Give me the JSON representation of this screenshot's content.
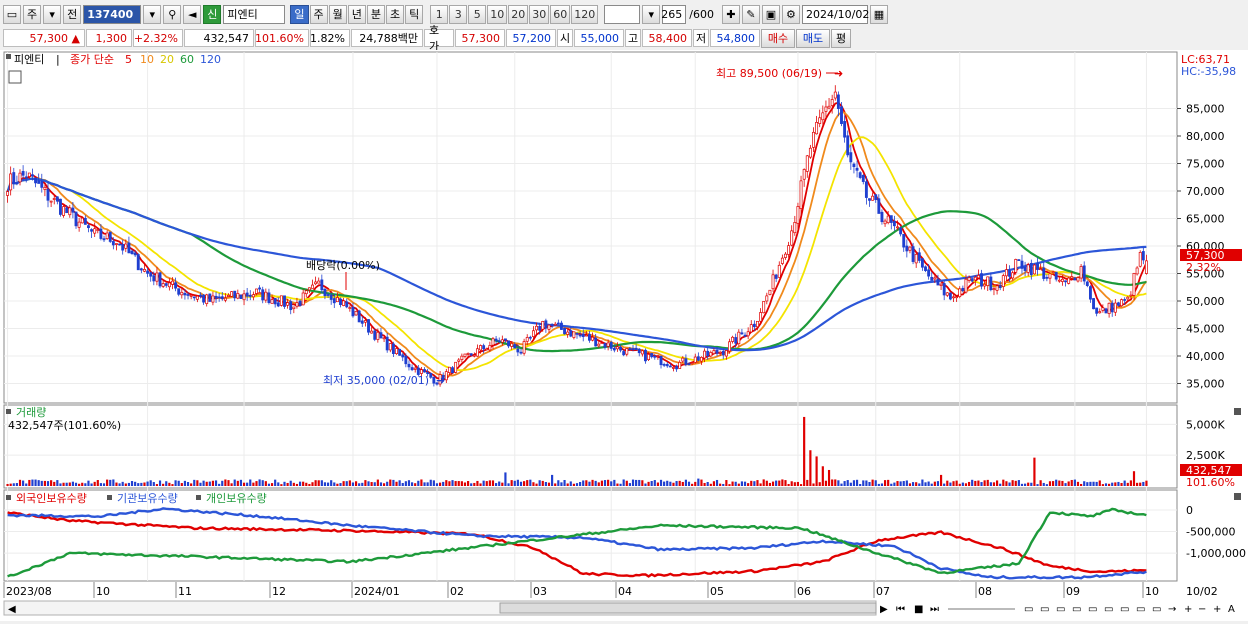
{
  "toolbar": {
    "type_label": "주",
    "prev_label": "전",
    "code": "137400",
    "credit_label": "신",
    "name": "피엔티",
    "periods": [
      "일",
      "주",
      "월",
      "년",
      "분",
      "초",
      "틱"
    ],
    "selected_period": "일",
    "nums": [
      "1",
      "3",
      "5",
      "10",
      "20",
      "30",
      "60",
      "120"
    ],
    "count": "265",
    "count_max": "/600",
    "date": "2024/10/02"
  },
  "quote": {
    "price": "57,300",
    "arrow": "▲",
    "change": "1,300",
    "change_pct": "+2.32%",
    "volume": "432,547",
    "vol_ratio": "101.60%",
    "turnover": "1.82%",
    "amount": "24,788백만",
    "hoga_label": "호가",
    "ask": "57,300",
    "bid": "57,200",
    "open_label": "시",
    "open": "55,000",
    "high_label": "고",
    "high": "58,400",
    "low_label": "저",
    "low": "54,800",
    "buy_label": "매수",
    "sell_label": "매도",
    "pyeong_label": "평"
  },
  "price_panel": {
    "name": "피엔티",
    "ma_title": "종가 단순",
    "ma_periods": [
      "5",
      "10",
      "20",
      "60",
      "120"
    ],
    "lc": "LC:63,71",
    "hc": "HC:-35,98",
    "high_note": "최고 89,500 (06/19)",
    "low_note": "최저 35,000 (02/01)",
    "div_note": "배당락(0.00%)",
    "price_tag": "57,300",
    "pct_tag": "2.32%"
  },
  "volume_panel": {
    "title": "거래량",
    "info": "432,547주(101.60%)",
    "tag": "432,547",
    "pct_tag": "101.60%"
  },
  "holdings_panel": {
    "legend": [
      "외국인보유수량",
      "기관보유수량",
      "개인보유수량"
    ]
  },
  "x_axis_labels": [
    "2023/08",
    "10",
    "11",
    "12",
    "2024/01",
    "02",
    "03",
    "04",
    "05",
    "06",
    "07",
    "08",
    "09",
    "10",
    "10/02"
  ],
  "colors": {
    "up": "#e00000",
    "down": "#1f3fd0",
    "ma5": "#e00000",
    "ma10": "#f08a1c",
    "ma20": "#f4e400",
    "ma60": "#1d9a3a",
    "ma120": "#2c56d8"
  },
  "chart_data": [
    {
      "type": "candlestick",
      "title": "피엔티",
      "ylim": [
        32000,
        92000
      ],
      "y_ticks": [
        35000,
        40000,
        45000,
        50000,
        55000,
        60000,
        65000,
        70000,
        75000,
        80000,
        85000
      ],
      "y_tick_labels": [
        "35,000",
        "40,000",
        "45,000",
        "50,000",
        "55,000",
        "60,000",
        "65,000",
        "70,000",
        "75,000",
        "80,000",
        "85,000"
      ],
      "last": {
        "open": 55000,
        "high": 58400,
        "low": 54800,
        "close": 57300
      },
      "anchors": [
        {
          "i": 0,
          "v": 71500
        },
        {
          "i": 6,
          "v": 73000
        },
        {
          "i": 15,
          "v": 68000
        },
        {
          "i": 28,
          "v": 62000
        },
        {
          "i": 35,
          "v": 61000
        },
        {
          "i": 45,
          "v": 55000
        },
        {
          "i": 55,
          "v": 52000
        },
        {
          "i": 65,
          "v": 50000
        },
        {
          "i": 80,
          "v": 51500
        },
        {
          "i": 92,
          "v": 49000
        },
        {
          "i": 100,
          "v": 53000
        },
        {
          "i": 108,
          "v": 49500
        },
        {
          "i": 118,
          "v": 44000
        },
        {
          "i": 130,
          "v": 38000
        },
        {
          "i": 138,
          "v": 35500
        },
        {
          "i": 148,
          "v": 40000
        },
        {
          "i": 158,
          "v": 43000
        },
        {
          "i": 165,
          "v": 41000
        },
        {
          "i": 172,
          "v": 46000
        },
        {
          "i": 185,
          "v": 43500
        },
        {
          "i": 198,
          "v": 41000
        },
        {
          "i": 215,
          "v": 38500
        },
        {
          "i": 230,
          "v": 41000
        },
        {
          "i": 240,
          "v": 46000
        },
        {
          "i": 245,
          "v": 52000
        },
        {
          "i": 252,
          "v": 63000
        },
        {
          "i": 258,
          "v": 78000
        },
        {
          "i": 263,
          "v": 85000
        },
        {
          "i": 266,
          "v": 88000
        },
        {
          "i": 270,
          "v": 76000
        },
        {
          "i": 276,
          "v": 69000
        },
        {
          "i": 285,
          "v": 63000
        },
        {
          "i": 295,
          "v": 55000
        },
        {
          "i": 303,
          "v": 50500
        },
        {
          "i": 310,
          "v": 54000
        },
        {
          "i": 318,
          "v": 53000
        },
        {
          "i": 325,
          "v": 57000
        },
        {
          "i": 333,
          "v": 55000
        },
        {
          "i": 340,
          "v": 53000
        },
        {
          "i": 345,
          "v": 56000
        },
        {
          "i": 350,
          "v": 47500
        },
        {
          "i": 355,
          "v": 49000
        },
        {
          "i": 360,
          "v": 50000
        },
        {
          "i": 364,
          "v": 58000
        },
        {
          "i": 366,
          "v": 57300
        }
      ],
      "ma_periods": [
        5,
        10,
        20,
        60,
        120
      ]
    },
    {
      "type": "bar",
      "title": "거래량",
      "ylim": [
        0,
        6000000
      ],
      "y_ticks": [
        2500000,
        5000000
      ],
      "y_tick_labels": [
        "2,500K",
        "5,000K"
      ],
      "base": 430000,
      "spikes": [
        {
          "i": 160,
          "v": 1100000
        },
        {
          "i": 175,
          "v": 900000
        },
        {
          "i": 222,
          "v": 600000
        },
        {
          "i": 256,
          "v": 5600000
        },
        {
          "i": 258,
          "v": 2900000
        },
        {
          "i": 260,
          "v": 2400000
        },
        {
          "i": 262,
          "v": 1600000
        },
        {
          "i": 264,
          "v": 1300000
        },
        {
          "i": 300,
          "v": 900000
        },
        {
          "i": 330,
          "v": 2300000
        },
        {
          "i": 362,
          "v": 1200000
        },
        {
          "i": 366,
          "v": 432547
        }
      ]
    },
    {
      "type": "line",
      "title": "보유수량",
      "ylim": [
        -1600000,
        300000
      ],
      "y_ticks": [
        0,
        -500000,
        -1000000
      ],
      "y_tick_labels": [
        "0",
        "-500,000",
        "-1,000,000"
      ],
      "series": [
        {
          "name": "외국인보유수량",
          "color": "#e00000",
          "anchors": [
            [
              0,
              -60000
            ],
            [
              20,
              -250000
            ],
            [
              60,
              -420000
            ],
            [
              110,
              -480000
            ],
            [
              150,
              -560000
            ],
            [
              170,
              -900000
            ],
            [
              185,
              -1480000
            ],
            [
              205,
              -1520000
            ],
            [
              240,
              -1420000
            ],
            [
              262,
              -1200000
            ],
            [
              280,
              -700000
            ],
            [
              300,
              -520000
            ],
            [
              320,
              -900000
            ],
            [
              335,
              -1300000
            ],
            [
              350,
              -1430000
            ],
            [
              366,
              -1400000
            ]
          ]
        },
        {
          "name": "기관보유수량",
          "color": "#2c56d8",
          "anchors": [
            [
              0,
              -120000
            ],
            [
              30,
              -150000
            ],
            [
              50,
              30000
            ],
            [
              80,
              -140000
            ],
            [
              110,
              -360000
            ],
            [
              150,
              -600000
            ],
            [
              185,
              -640000
            ],
            [
              210,
              -920000
            ],
            [
              240,
              -880000
            ],
            [
              262,
              -720000
            ],
            [
              285,
              -840000
            ],
            [
              300,
              -1350000
            ],
            [
              315,
              -1560000
            ],
            [
              345,
              -1560000
            ],
            [
              366,
              -1430000
            ]
          ]
        },
        {
          "name": "개인보유수량",
          "color": "#1d9a3a",
          "anchors": [
            [
              0,
              -1560000
            ],
            [
              20,
              -1000000
            ],
            [
              60,
              -1080000
            ],
            [
              110,
              -1200000
            ],
            [
              140,
              -950000
            ],
            [
              175,
              -650000
            ],
            [
              210,
              -360000
            ],
            [
              255,
              -420000
            ],
            [
              275,
              -900000
            ],
            [
              300,
              -1460000
            ],
            [
              325,
              -1240000
            ],
            [
              335,
              -50000
            ],
            [
              348,
              -150000
            ],
            [
              355,
              0
            ],
            [
              366,
              -120000
            ]
          ]
        }
      ]
    }
  ]
}
